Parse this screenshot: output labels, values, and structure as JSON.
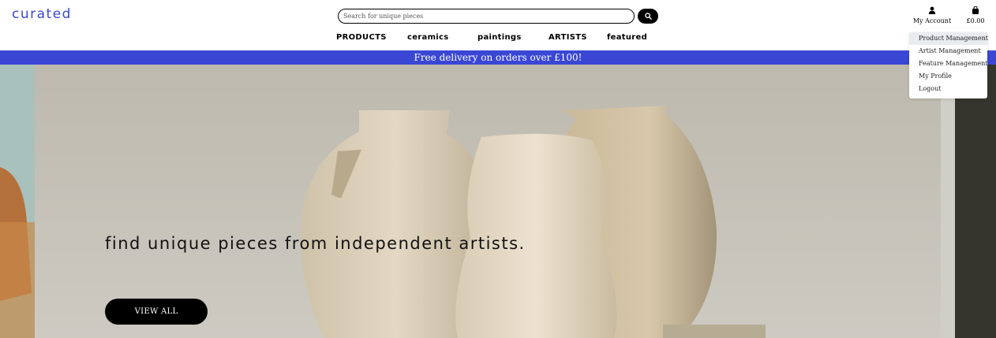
{
  "header": {
    "logo": "curated",
    "search": {
      "placeholder": "Search for unique pieces"
    },
    "nav": [
      "PRODUCTS",
      "ceramics",
      "paintings",
      "ARTISTS",
      "featured"
    ],
    "account_label": "My Account",
    "bag_total": "£0.00"
  },
  "account_menu": [
    "Product Management",
    "Artist Management",
    "Feature Management",
    "My Profile",
    "Logout"
  ],
  "banner": "Free delivery on orders over £100!",
  "hero": {
    "tagline": "find unique pieces from independent artists.",
    "cta": "VIEW ALL"
  },
  "colors": {
    "brand": "#3a47d5",
    "button": "#000000"
  },
  "icons": {
    "search": "search-icon",
    "account": "user-icon",
    "bag": "shopping-bag-icon"
  }
}
